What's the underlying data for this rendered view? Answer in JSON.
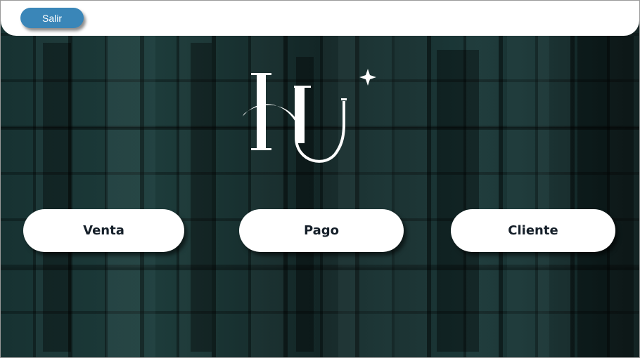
{
  "header": {
    "exit_label": "Salir"
  },
  "logo": {
    "text": "HU"
  },
  "menu": {
    "items": [
      {
        "label": "Venta"
      },
      {
        "label": "Pago"
      },
      {
        "label": "Cliente"
      }
    ]
  },
  "colors": {
    "accent": "#3a86b8",
    "background": "#142a2a",
    "button_bg": "#ffffff",
    "button_text": "#16202a"
  }
}
